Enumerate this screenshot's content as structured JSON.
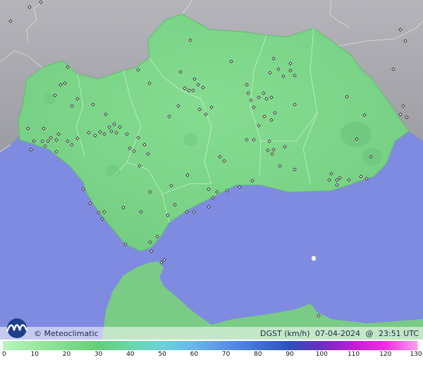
{
  "map": {
    "brand": "© Meteoclimatic",
    "variable": "DGST (km/h)",
    "date": "07-04-2024",
    "at_symbol": "@",
    "time": "23:51 UTC",
    "colors": {
      "sea": "#7f8be0",
      "land_outside": "#a7a7ad",
      "region_fill": "#7fd98a",
      "region_edge": "#58b866",
      "border": "#ffffff"
    }
  },
  "legend": {
    "ticks": [
      "0",
      "10",
      "20",
      "30",
      "40",
      "50",
      "60",
      "70",
      "80",
      "90",
      "100",
      "110",
      "120",
      "130"
    ],
    "colors": [
      "#b9f5bf",
      "#9be9a3",
      "#7fdc8c",
      "#63cf78",
      "#6ad6a8",
      "#6cd2d8",
      "#69b5ec",
      "#5a92e6",
      "#3f6fd8",
      "#2d4fb8",
      "#6c2fc0",
      "#c11dd6",
      "#f12ee0",
      "#f8a0f0"
    ]
  },
  "icons": {
    "logo": "meteoclimatic-logo",
    "station": "station-marker-icon"
  }
}
